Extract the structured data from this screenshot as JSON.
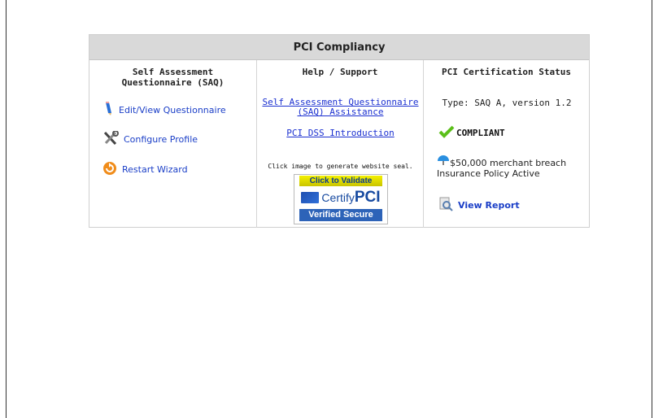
{
  "header": {
    "title": "PCI Compliancy"
  },
  "saq": {
    "title_line1": "Self Assessment",
    "title_line2": "Questionnaire (SAQ)",
    "items": [
      {
        "label": "Edit/View Questionnaire",
        "icon": "pencil-icon"
      },
      {
        "label": "Configure Profile",
        "icon": "tools-icon"
      },
      {
        "label": "Restart Wizard",
        "icon": "restart-icon"
      }
    ]
  },
  "help": {
    "title": "Help / Support",
    "link1_line1": "Self Assessment Questionnaire",
    "link1_line2": "(SAQ) Assistance",
    "link2": "PCI DSS Introduction",
    "seal_caption": "Click image to generate website seal.",
    "seal": {
      "top": "Click to Validate",
      "certify": "Certify",
      "pci": "PCI",
      "bottom": "Verified Secure"
    }
  },
  "status": {
    "title": "PCI Certification Status",
    "type": "Type: SAQ A, version 1.2",
    "compliance": "COMPLIANT",
    "insurance_line1": "$50,000 merchant breach",
    "insurance_line2": "Insurance Policy Active",
    "report_label": "View Report"
  },
  "colors": {
    "header_bg": "#d9d9d9",
    "link": "#1a3ec7",
    "check": "#5bbf1a"
  }
}
